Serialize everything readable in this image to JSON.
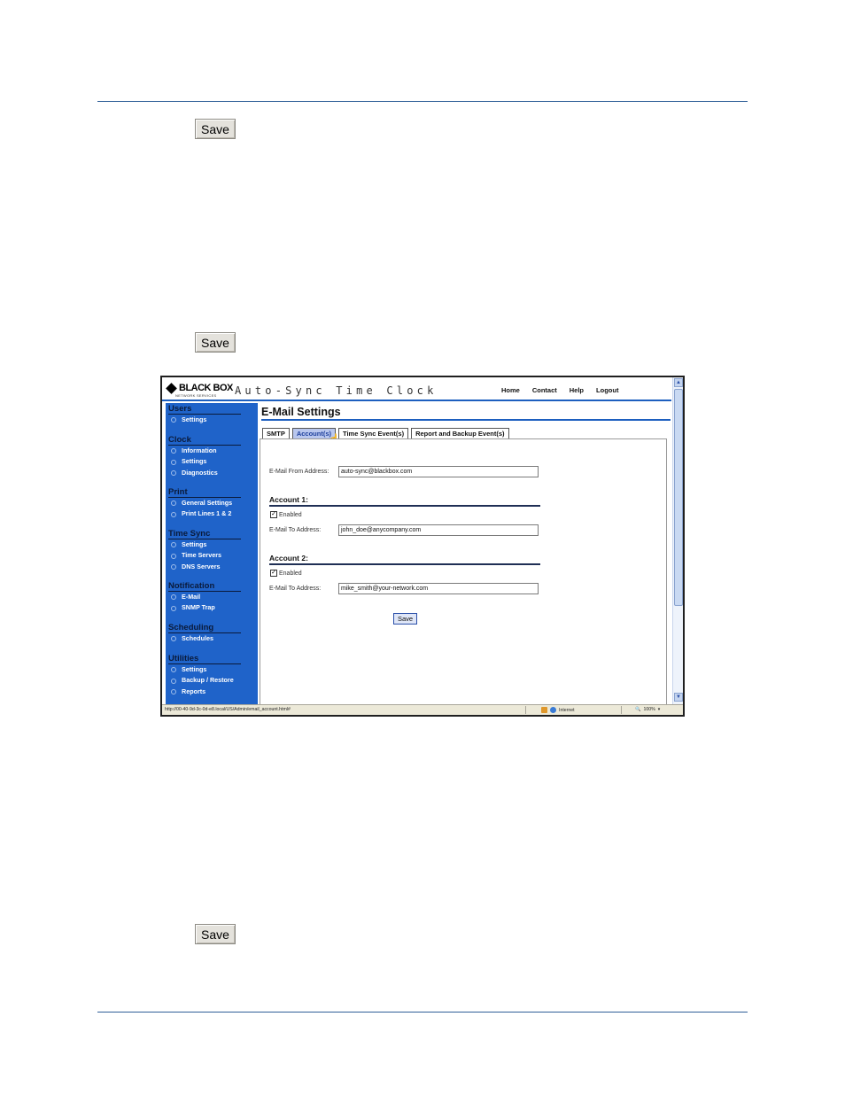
{
  "doc": {
    "save_label_1": "Save",
    "save_label_2": "Save",
    "save_label_3": "Save"
  },
  "screenshot": {
    "logo_text": "BLACK BOX",
    "logo_subtext": "NETWORK SERVICES",
    "app_title": "Auto-Sync Time Clock",
    "top_nav": [
      "Home",
      "Contact",
      "Help",
      "Logout"
    ],
    "sidebar": [
      {
        "title": "Users",
        "items": [
          "Settings"
        ]
      },
      {
        "title": "Clock",
        "items": [
          "Information",
          "Settings",
          "Diagnostics"
        ]
      },
      {
        "title": "Print",
        "items": [
          "General Settings",
          "Print Lines 1 & 2"
        ]
      },
      {
        "title": "Time Sync",
        "items": [
          "Settings",
          "Time Servers",
          "DNS Servers"
        ]
      },
      {
        "title": "Notification",
        "items": [
          "E-Mail",
          "SNMP Trap"
        ]
      },
      {
        "title": "Scheduling",
        "items": [
          "Schedules"
        ]
      },
      {
        "title": "Utilities",
        "items": [
          "Settings",
          "Backup / Restore",
          "Reports"
        ]
      }
    ],
    "page_title": "E-Mail Settings",
    "tabs": [
      "SMTP",
      "Account(s)",
      "Time Sync Event(s)",
      "Report and Backup Event(s)"
    ],
    "active_tab": "Account(s)",
    "form": {
      "from_label": "E-Mail From Address:",
      "from_value": "auto-sync@blackbox.com",
      "account1_title": "Account 1:",
      "account1_enabled_label": "Enabled",
      "account1_to_label": "E-Mail To Address:",
      "account1_to_value": "john_doe@anycompany.com",
      "account2_title": "Account 2:",
      "account2_enabled_label": "Enabled",
      "account2_to_label": "E-Mail To Address:",
      "account2_to_value": "mike_smith@your-network.com",
      "save_label": "Save"
    },
    "status": {
      "url": "http://00-40-9d-3c-0d-e8.local/US/Admin/email_account.html#",
      "zone": "Internet",
      "zoom": "100%"
    },
    "colors": {
      "sidebar": "#1f63c9",
      "accent": "#1d5fbf",
      "active_tab": "#b9c7ee"
    }
  }
}
